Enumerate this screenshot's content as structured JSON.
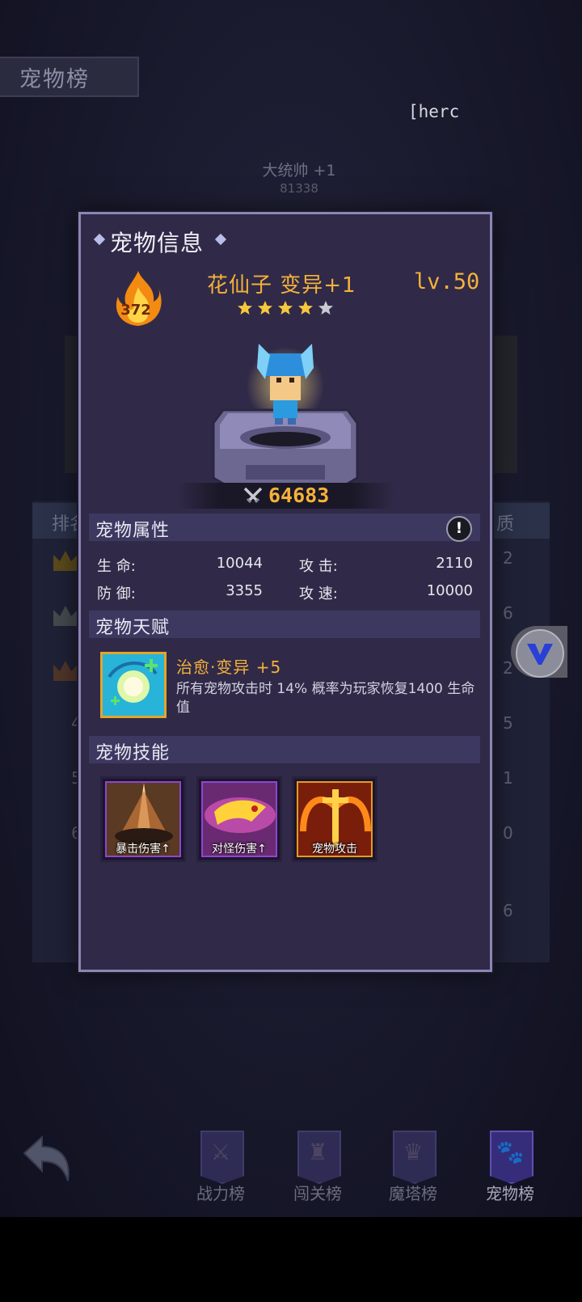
{
  "page": {
    "title": "宠物榜",
    "hero_tag": "[herc"
  },
  "background_list": {
    "top_player_name": "大统帅 +1",
    "top_player_score": "81338",
    "header_left": "排名",
    "header_right": "质",
    "row_values": [
      "2",
      "6",
      "2",
      "5",
      "1",
      "0",
      "6"
    ],
    "row_ranks": [
      "4",
      "5",
      "6"
    ]
  },
  "modal": {
    "title": "宠物信息",
    "fire_value": "372",
    "pet_name": "花仙子 变异+1",
    "level": "lv.50",
    "stars_filled": 4,
    "stars_total": 5,
    "power": "64683",
    "sections": {
      "attributes": "宠物属性",
      "talent": "宠物天赋",
      "skills": "宠物技能"
    },
    "stats": {
      "hp_label": "生 命:",
      "hp_value": "10044",
      "atk_label": "攻 击:",
      "atk_value": "2110",
      "def_label": "防 御:",
      "def_value": "3355",
      "spd_label": "攻 速:",
      "spd_value": "10000"
    },
    "talent": {
      "name": "治愈·变异 +5",
      "description": "所有宠物攻击时 14% 概率为玩家恢复1400 生命值"
    },
    "skills": [
      {
        "label": "暴击伤害↑"
      },
      {
        "label": "对怪伤害↑"
      },
      {
        "label": "宠物攻击"
      }
    ]
  },
  "bottom_nav": {
    "tabs": [
      {
        "label": "战力榜"
      },
      {
        "label": "闯关榜"
      },
      {
        "label": "魔塔榜"
      },
      {
        "label": "宠物榜"
      }
    ]
  },
  "colors": {
    "accent": "#f5b13a",
    "modal_bg": "#302a48",
    "section_bg": "#3d3860"
  }
}
